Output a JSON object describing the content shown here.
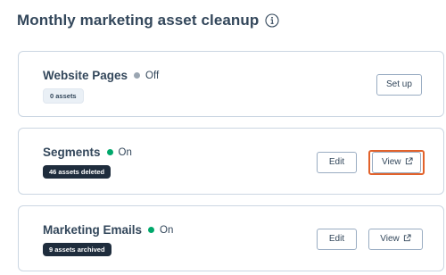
{
  "header": {
    "title": "Monthly marketing asset cleanup",
    "info_icon": "info-icon"
  },
  "colors": {
    "on": "#00a86b",
    "off": "#9aa5b1",
    "highlight": "#e2622b",
    "badge_dark": "#1f2d3d"
  },
  "cards": [
    {
      "title": "Website Pages",
      "status": "Off",
      "badge": "0 assets",
      "buttons": {
        "setup": "Set up"
      }
    },
    {
      "title": "Segments",
      "status": "On",
      "badge": "46 assets deleted",
      "buttons": {
        "edit": "Edit",
        "view": "View"
      }
    },
    {
      "title": "Marketing Emails",
      "status": "On",
      "badge": "9 assets archived",
      "buttons": {
        "edit": "Edit",
        "view": "View"
      }
    }
  ]
}
